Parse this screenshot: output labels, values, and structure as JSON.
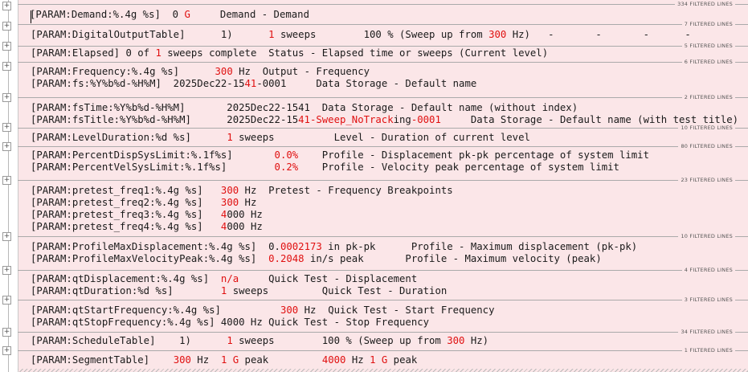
{
  "separator_labels": [
    "334 FILTERED LINES",
    "7 FILTERED LINES",
    "5 FILTERED LINES",
    "6 FILTERED LINES",
    "2 FILTERED LINES",
    "10 FILTERED LINES",
    "80 FILTERED LINES",
    "23 FILTERED LINES",
    "10 FILTERED LINES",
    "4 FILTERED LINES",
    "3 FILTERED LINES",
    "34 FILTERED LINES",
    "1 FILTERED LINES"
  ],
  "lines": [
    [
      {
        "t": "[PARAM:Demand:%.4g %s]  0 "
      },
      {
        "t": "G",
        "r": 1
      },
      {
        "t": "     Demand - Demand"
      }
    ],
    [
      {
        "t": "[PARAM:DigitalOutputTable]      1)      "
      },
      {
        "t": "1",
        "r": 1
      },
      {
        "t": " sweeps        100 % (Sweep up from "
      },
      {
        "t": "300",
        "r": 1
      },
      {
        "t": " Hz)   -       -       -      -"
      }
    ],
    [
      {
        "t": "[PARAM:Elapsed] 0 of "
      },
      {
        "t": "1",
        "r": 1
      },
      {
        "t": " sweeps complete  Status - Elapsed time or sweeps (Current level)"
      }
    ],
    [
      {
        "t": "[PARAM:Frequency:%.4g %s]      "
      },
      {
        "t": "300",
        "r": 1
      },
      {
        "t": " Hz  Output - Frequency"
      }
    ],
    [
      {
        "t": "[PARAM:fs:%Y%b%d-%H%M]  2025Dec22-15"
      },
      {
        "t": "41",
        "r": 1
      },
      {
        "t": "-0001     Data Storage - Default name"
      }
    ],
    [
      {
        "t": "[PARAM:fsTime:%Y%b%d-%H%M]       2025Dec22-1541  Data Storage - Default name (without index)"
      }
    ],
    [
      {
        "t": "[PARAM:fsTitle:%Y%b%d-%H%M]      2025Dec22-15"
      },
      {
        "t": "41-Sweep_NoTrack",
        "r": 1
      },
      {
        "t": "ing"
      },
      {
        "t": "-0001",
        "r": 1
      },
      {
        "t": "     Data Storage - Default name (with test title)"
      }
    ],
    [
      {
        "t": "[PARAM:LevelDuration:%d %s]      "
      },
      {
        "t": "1",
        "r": 1
      },
      {
        "t": " sweeps          Level - Duration of current level"
      }
    ],
    [
      {
        "t": "[PARAM:PercentDispSysLimit:%.1f%s]       "
      },
      {
        "t": "0.0%",
        "r": 1
      },
      {
        "t": "    Profile - Displacement pk-pk percentage of system limit"
      }
    ],
    [
      {
        "t": "[PARAM:PercentVelSysLimit:%.1f%s]        "
      },
      {
        "t": "0.2%",
        "r": 1
      },
      {
        "t": "    Profile - Velocity peak percentage of system limit"
      }
    ],
    [
      {
        "t": "[PARAM:pretest_freq1:%.4g %s]   "
      },
      {
        "t": "300",
        "r": 1
      },
      {
        "t": " Hz  Pretest - Frequency Breakpoints"
      }
    ],
    [
      {
        "t": "[PARAM:pretest_freq2:%.4g %s]   "
      },
      {
        "t": "300",
        "r": 1
      },
      {
        "t": " Hz"
      }
    ],
    [
      {
        "t": "[PARAM:pretest_freq3:%.4g %s]   "
      },
      {
        "t": "4",
        "r": 1
      },
      {
        "t": "000 Hz"
      }
    ],
    [
      {
        "t": "[PARAM:pretest_freq4:%.4g %s]   "
      },
      {
        "t": "4",
        "r": 1
      },
      {
        "t": "000 Hz"
      }
    ],
    [
      {
        "t": "[PARAM:ProfileMaxDisplacement:%.4g %s]  0."
      },
      {
        "t": "0002173",
        "r": 1
      },
      {
        "t": " in pk-pk      Profile - Maximum displacement (pk-pk)"
      }
    ],
    [
      {
        "t": "[PARAM:ProfileMaxVelocityPeak:%.4g %s]  "
      },
      {
        "t": "0.2048",
        "r": 1
      },
      {
        "t": " in/s peak       Profile - Maximum velocity (peak)"
      }
    ],
    [
      {
        "t": "[PARAM:qtDisplacement:%.4g %s]  "
      },
      {
        "t": "n/a",
        "r": 1
      },
      {
        "t": "     Quick Test - Displacement"
      }
    ],
    [
      {
        "t": "[PARAM:qtDuration:%d %s]        "
      },
      {
        "t": "1",
        "r": 1
      },
      {
        "t": " sweeps         Quick Test - Duration"
      }
    ],
    [
      {
        "t": "[PARAM:qtStartFrequency:%.4g %s]          "
      },
      {
        "t": "300",
        "r": 1
      },
      {
        "t": " Hz  Quick Test - Start Frequency"
      }
    ],
    [
      {
        "t": "[PARAM:qtStopFrequency:%.4g %s] 4000 Hz Quick Test - Stop Frequency"
      }
    ],
    [
      {
        "t": "[PARAM:ScheduleTable]    1)      "
      },
      {
        "t": "1",
        "r": 1
      },
      {
        "t": " sweeps        100 % (Sweep up from "
      },
      {
        "t": "300",
        "r": 1
      },
      {
        "t": " Hz)"
      }
    ],
    [
      {
        "t": "[PARAM:SegmentTable]    "
      },
      {
        "t": "300",
        "r": 1
      },
      {
        "t": " Hz  "
      },
      {
        "t": "1 G",
        "r": 1
      },
      {
        "t": " peak         "
      },
      {
        "t": "4000",
        "r": 1
      },
      {
        "t": " Hz "
      },
      {
        "t": "1 G",
        "r": 1
      },
      {
        "t": " peak"
      }
    ]
  ]
}
